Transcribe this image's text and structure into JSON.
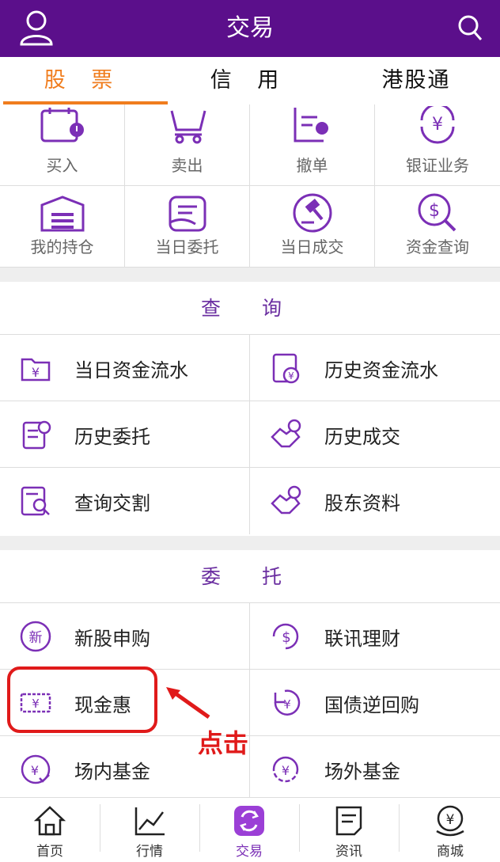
{
  "header": {
    "title": "交易",
    "user_icon": "user-icon",
    "search_icon": "search-icon"
  },
  "tabs": [
    {
      "label": "股 票"
    },
    {
      "label": "信 用"
    },
    {
      "label": "港股通"
    }
  ],
  "grid": [
    {
      "label": "买入",
      "icon": "calendar-buy-icon"
    },
    {
      "label": "卖出",
      "icon": "cart-sell-icon"
    },
    {
      "label": "撤单",
      "icon": "cancel-order-icon"
    },
    {
      "label": "银证业务",
      "icon": "bank-transfer-icon"
    },
    {
      "label": "我的持仓",
      "icon": "warehouse-icon"
    },
    {
      "label": "当日委托",
      "icon": "hand-order-icon"
    },
    {
      "label": "当日成交",
      "icon": "gavel-icon"
    },
    {
      "label": "资金查询",
      "icon": "dollar-search-icon"
    }
  ],
  "query": {
    "title": "查 询",
    "items": [
      {
        "label": "当日资金流水",
        "icon": "folder-yen-icon"
      },
      {
        "label": "历史资金流水",
        "icon": "doc-yen-icon"
      },
      {
        "label": "历史委托",
        "icon": "doc-clock-icon"
      },
      {
        "label": "历史成交",
        "icon": "handshake-clock-icon"
      },
      {
        "label": "查询交割",
        "icon": "doc-search-icon"
      },
      {
        "label": "股东资料",
        "icon": "handshake-clock-icon"
      }
    ]
  },
  "entrust": {
    "title": "委 托",
    "items": [
      {
        "label": "新股申购",
        "icon": "new-badge-icon"
      },
      {
        "label": "联讯理财",
        "icon": "dollar-refresh-icon"
      },
      {
        "label": "现金惠",
        "icon": "ticket-yen-icon"
      },
      {
        "label": "国债逆回购",
        "icon": "reverse-yen-icon"
      },
      {
        "label": "场内基金",
        "icon": "yen-check-icon"
      },
      {
        "label": "场外基金",
        "icon": "yen-refresh-icon"
      }
    ]
  },
  "annotation": {
    "click_label": "点击"
  },
  "bottom_nav": [
    {
      "label": "首页",
      "icon": "home-icon"
    },
    {
      "label": "行情",
      "icon": "chart-line-icon"
    },
    {
      "label": "交易",
      "icon": "swap-icon"
    },
    {
      "label": "资讯",
      "icon": "news-icon"
    },
    {
      "label": "商城",
      "icon": "mall-yen-icon"
    }
  ],
  "colors": {
    "header": "#5b0f8b",
    "accent": "#f07d1e",
    "icon": "#7b2fb6",
    "highlight": "#e01a1a"
  }
}
